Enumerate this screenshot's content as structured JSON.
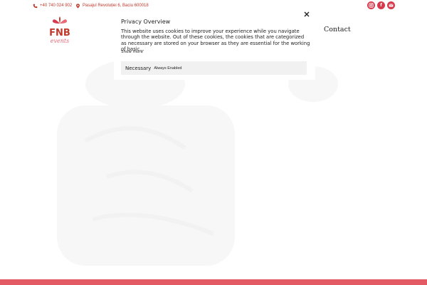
{
  "topbar": {
    "phone": "+40 740 024 902",
    "address": "Pasajul Revoluției 6, Baciu 600018",
    "social": [
      {
        "name": "instagram-icon"
      },
      {
        "name": "facebook-icon",
        "glyph": "f"
      },
      {
        "name": "mail-icon"
      }
    ]
  },
  "logo": {
    "text": "FNB",
    "script": "events"
  },
  "nav": {
    "contact": "Contact"
  },
  "modal": {
    "title": "Privacy Overview",
    "text": "This website uses cookies to improve your experience while you navigate through the website. Out of these cookies, the cookies that are categorized as necessary are stored on your browser as they are essential for the working of basic...",
    "show_more": "Show more",
    "necessary_label": "Necessary",
    "necessary_status": "Always Enabled"
  },
  "colors": {
    "accent": "#d83a4d",
    "bottom_band": "#e35a64",
    "text": "#222222"
  }
}
